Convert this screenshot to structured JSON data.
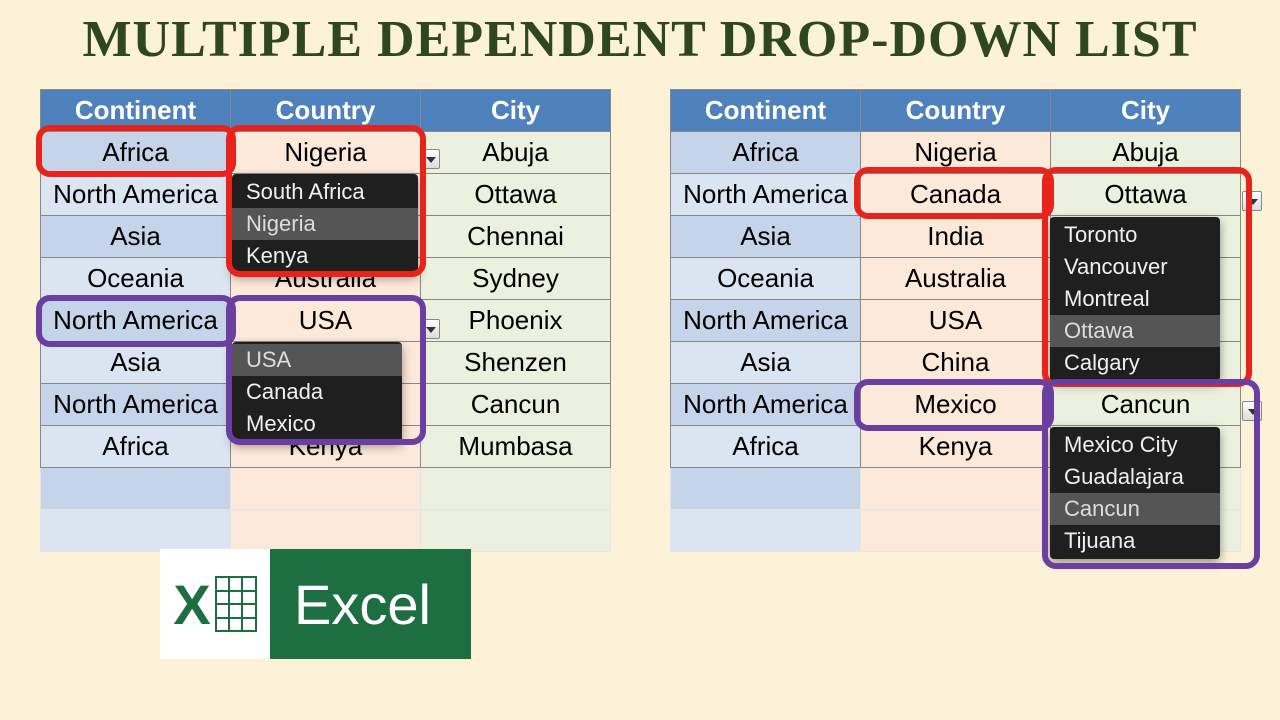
{
  "title": "MULTIPLE DEPENDENT DROP-DOWN LIST",
  "headers": {
    "continent": "Continent",
    "country": "Country",
    "city": "City"
  },
  "rows": [
    {
      "continent": "Africa",
      "country": "Nigeria",
      "city": "Abuja"
    },
    {
      "continent": "North America",
      "country": "Canada",
      "city": "Ottawa"
    },
    {
      "continent": "Asia",
      "country": "India",
      "city": "Chennai"
    },
    {
      "continent": "Oceania",
      "country": "Australia",
      "city": "Sydney"
    },
    {
      "continent": "North America",
      "country": "USA",
      "city": "Phoenix"
    },
    {
      "continent": "Asia",
      "country": "China",
      "city": "Shenzen"
    },
    {
      "continent": "North America",
      "country": "Mexico",
      "city": "Cancun"
    },
    {
      "continent": "Africa",
      "country": "Kenya",
      "city": "Mumbasa"
    }
  ],
  "left_overrides": {
    "1": {
      "country": ""
    },
    "2": {
      "country": ""
    },
    "5": {
      "country_suffix": "na"
    },
    "6": {
      "country_suffix": "xico"
    }
  },
  "dropdowns": {
    "africa_countries": {
      "options": [
        "South Africa",
        "Nigeria",
        "Kenya"
      ],
      "selected": "Nigeria"
    },
    "na_countries": {
      "options": [
        "USA",
        "Canada",
        "Mexico"
      ],
      "selected": "USA"
    },
    "canada_cities": {
      "options": [
        "Toronto",
        "Vancouver",
        "Montreal",
        "Ottawa",
        "Calgary"
      ],
      "selected": "Ottawa"
    },
    "mexico_cities": {
      "options": [
        "Mexico City",
        "Guadalajara",
        "Cancun",
        "Tijuana"
      ],
      "selected": "Cancun"
    }
  },
  "logo": {
    "letter": "X",
    "word": "Excel"
  }
}
